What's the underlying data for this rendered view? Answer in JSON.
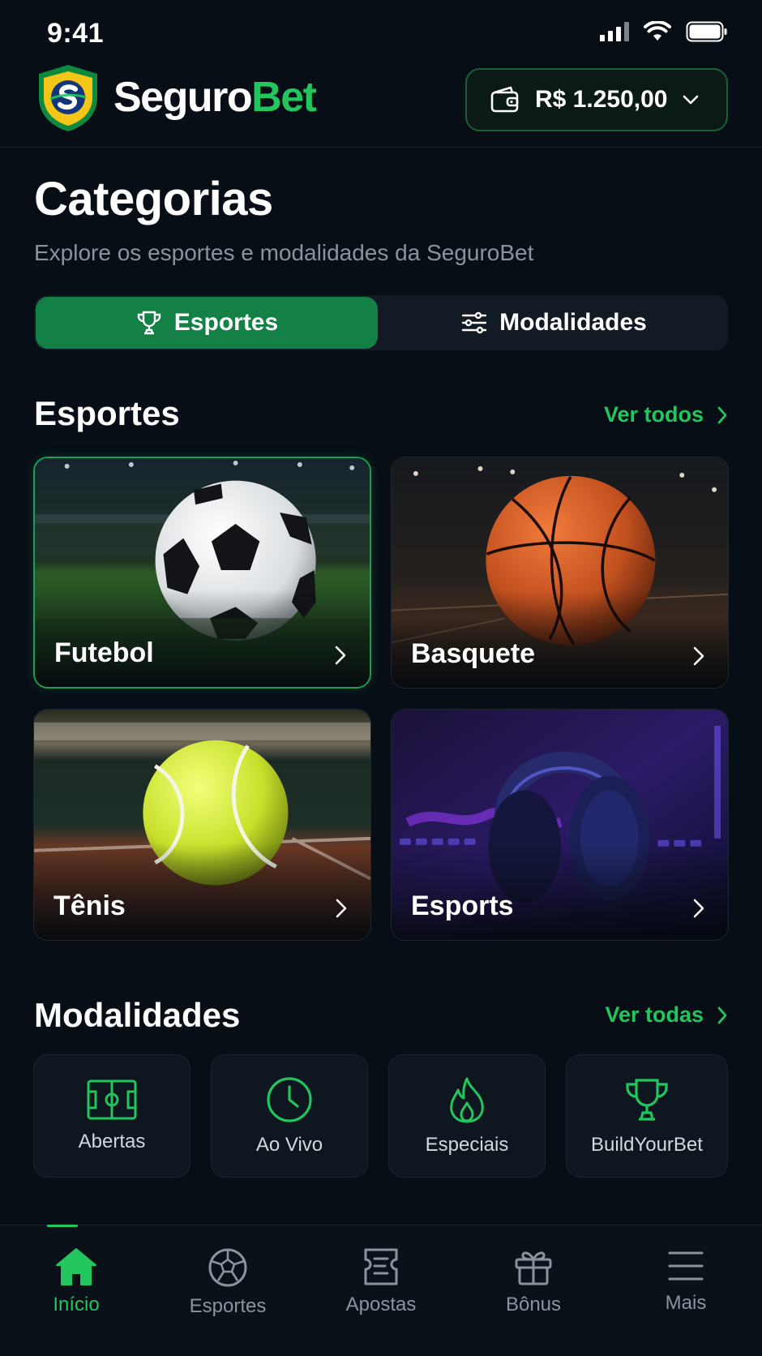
{
  "status_bar": {
    "time": "9:41"
  },
  "header": {
    "brand_part1": "Seguro",
    "brand_part2": "Bet",
    "balance": "R$ 1.250,00"
  },
  "page": {
    "title": "Categorias",
    "subtitle": "Explore os esportes e modalidades da SeguroBet"
  },
  "segmented": {
    "tabs": [
      {
        "label": "Esportes",
        "icon": "trophy-icon",
        "active": true
      },
      {
        "label": "Modalidades",
        "icon": "sliders-icon",
        "active": false
      }
    ]
  },
  "sports_section": {
    "title": "Esportes",
    "see_all": "Ver todos",
    "cards": [
      {
        "label": "Futebol",
        "image": "soccer-ball",
        "selected": true
      },
      {
        "label": "Basquete",
        "image": "basketball",
        "selected": false
      },
      {
        "label": "Tênis",
        "image": "tennis-ball",
        "selected": false
      },
      {
        "label": "Esports",
        "image": "gaming-headset",
        "selected": false
      }
    ]
  },
  "modes_section": {
    "title": "Modalidades",
    "see_all": "Ver todas",
    "items": [
      {
        "label": "Abertas",
        "icon": "field-icon"
      },
      {
        "label": "Ao Vivo",
        "icon": "clock-icon"
      },
      {
        "label": "Especiais",
        "icon": "flame-icon"
      },
      {
        "label": "BuildYourBet",
        "icon": "trophy-icon"
      }
    ]
  },
  "bottom_nav": {
    "items": [
      {
        "label": "Início",
        "icon": "home-icon",
        "active": true
      },
      {
        "label": "Esportes",
        "icon": "soccer-ball-icon",
        "active": false
      },
      {
        "label": "Apostas",
        "icon": "ticket-icon",
        "active": false
      },
      {
        "label": "Bônus",
        "icon": "gift-icon",
        "active": false
      },
      {
        "label": "Mais",
        "icon": "menu-icon",
        "active": false
      }
    ]
  },
  "colors": {
    "accent": "#22c55e",
    "active_tab": "#138046",
    "background": "#070e15",
    "muted_text": "#8b949e"
  }
}
